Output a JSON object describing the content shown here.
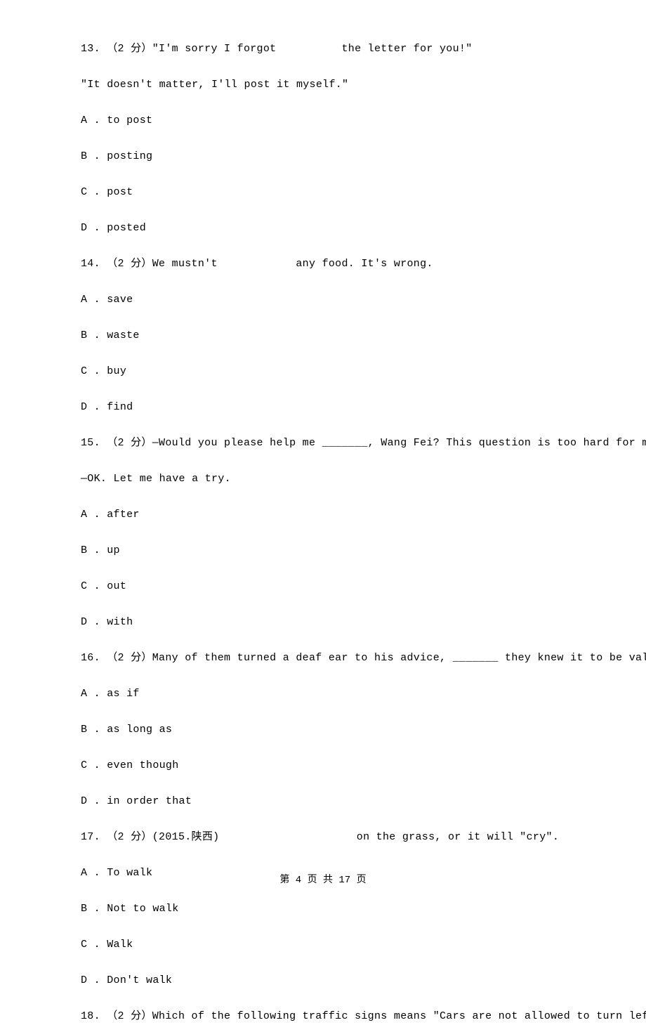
{
  "questions": [
    {
      "number": "13.",
      "points": "（2 分）",
      "line1": "\"I'm sorry I forgot          the letter for you!\"",
      "line2": "\"It doesn't matter, I'll post it myself.\"",
      "options": {
        "A": "to post",
        "B": "posting",
        "C": "post",
        "D": "posted"
      }
    },
    {
      "number": "14.",
      "points": "（2 分）",
      "line1": "We mustn't            any food. It's wrong.",
      "options": {
        "A": "save",
        "B": "waste",
        "C": "buy",
        "D": "find"
      }
    },
    {
      "number": "15.",
      "points": "（2 分）",
      "line1": "—Would you please help me _______, Wang Fei? This question is too hard for me.",
      "line2": "—OK. Let me have a try.",
      "options": {
        "A": "after",
        "B": "up",
        "C": "out",
        "D": "with"
      }
    },
    {
      "number": "16.",
      "points": "（2 分）",
      "line1": "Many of them turned a deaf ear to his advice, _______ they knew it to be valuable.",
      "options": {
        "A": "as if",
        "B": "as long as",
        "C": "even though",
        "D": "in order that"
      }
    },
    {
      "number": "17.",
      "points": "（2 分）",
      "line1": "(2015.陕西)                     on the grass, or it will \"cry\".",
      "options": {
        "A": "To walk",
        "B": "Not to walk",
        "C": "Walk",
        "D": "Don't walk"
      }
    },
    {
      "number": "18.",
      "points": "（2 分）",
      "line1": "Which of the following traffic signs means \"Cars are not allowed to turn left here\"?"
    }
  ],
  "footer": "第 4 页 共 17 页"
}
